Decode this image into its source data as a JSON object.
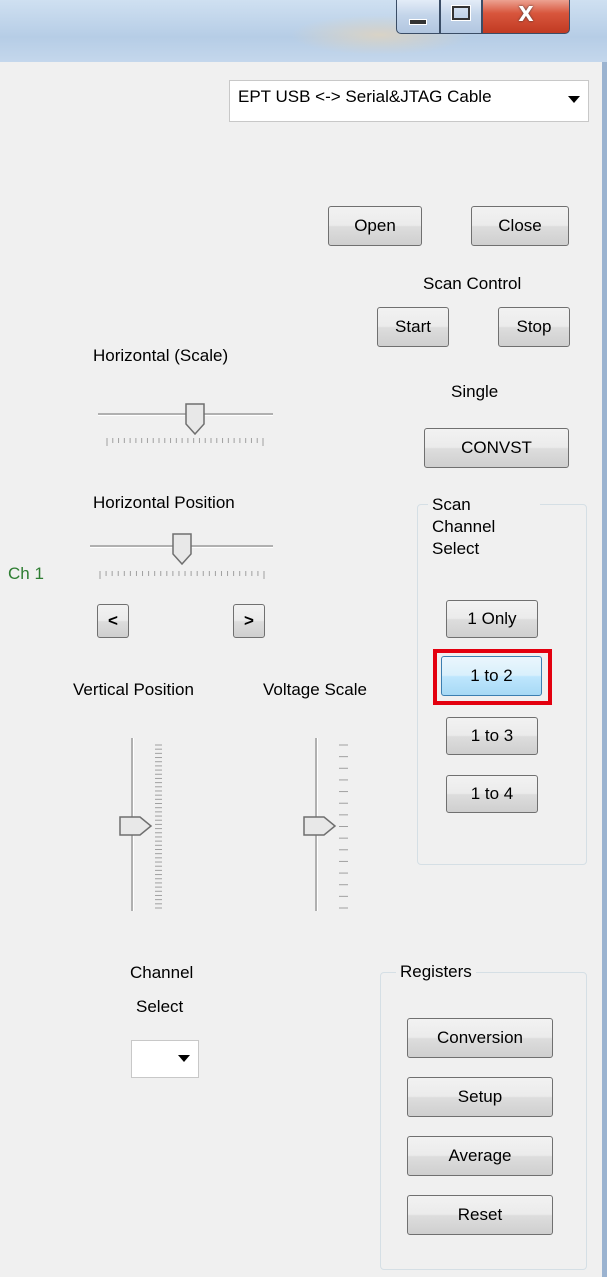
{
  "device_combo": {
    "value": "EPT USB <-> Serial&JTAG Cable"
  },
  "buttons": {
    "open": "Open",
    "close": "Close",
    "start": "Start",
    "stop": "Stop",
    "convst": "CONVST",
    "prev": "<",
    "next": ">"
  },
  "labels": {
    "scan_control": "Scan Control",
    "single": "Single",
    "horizontal_scale": "Horizontal  (Scale)",
    "horizontal_position": "Horizontal Position",
    "channel_indicator": "Ch 1",
    "vertical_position": "Vertical Position",
    "voltage_scale": "Voltage Scale",
    "channel_select_1": "Channel",
    "channel_select_2": "Select"
  },
  "scan_channel_select": {
    "caption_lines": [
      "Scan",
      "Channel",
      "Select"
    ],
    "options": [
      "1 Only",
      "1 to 2",
      "1 to 3",
      "1 to 4"
    ],
    "selected": "1 to 2"
  },
  "registers": {
    "caption": "Registers",
    "buttons": [
      "Conversion",
      "Setup",
      "Average",
      "Reset"
    ]
  },
  "channel_select_combo": {
    "value": ""
  },
  "sliders": {
    "horizontal_scale": 0.55,
    "horizontal_position": 0.5,
    "vertical_position": 0.5,
    "voltage_scale": 0.5
  },
  "colors": {
    "channel_indicator": "#2e7d32",
    "highlight": "#e3000f",
    "selected_button": "#bee6fd"
  },
  "icons": {
    "minimize": "minimize-icon",
    "maximize": "maximize-icon",
    "close": "close-icon",
    "dropdown": "chevron-down-icon"
  }
}
